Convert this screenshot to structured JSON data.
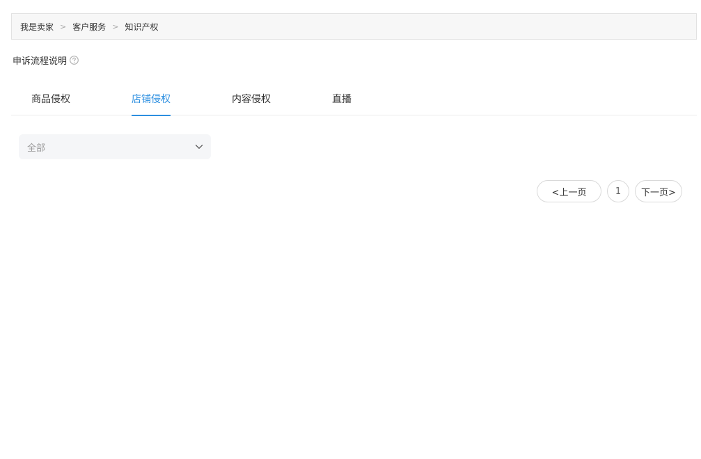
{
  "breadcrumb": {
    "items": [
      "我是卖家",
      "客户服务",
      "知识产权"
    ],
    "separator": ">"
  },
  "appeal": {
    "title": "申诉流程说明",
    "help_icon": "question-circle-icon"
  },
  "tabs": [
    {
      "label": "商品侵权",
      "active": false
    },
    {
      "label": "店铺侵权",
      "active": true
    },
    {
      "label": "内容侵权",
      "active": false
    },
    {
      "label": "直播",
      "active": false
    }
  ],
  "filter": {
    "selected": "全部",
    "icon": "chevron-down-icon"
  },
  "pagination": {
    "prev_label": "<上一页",
    "current_page": "1",
    "next_label": "下一页>"
  },
  "colors": {
    "accent": "#2d8fe0",
    "breadcrumb_bg": "#f7f7f7",
    "select_bg": "#f5f6f8",
    "placeholder": "#9a9a9a"
  }
}
